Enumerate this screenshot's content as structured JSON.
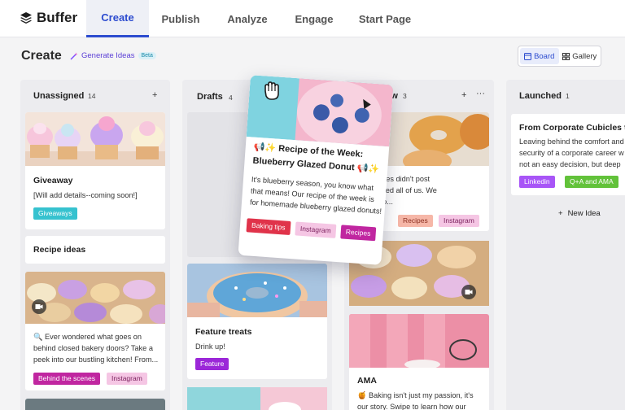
{
  "app": {
    "logo_text": "Buffer"
  },
  "nav": {
    "tabs": [
      "Create",
      "Publish",
      "Analyze",
      "Engage",
      "Start Page"
    ]
  },
  "header": {
    "title": "Create",
    "generate_ideas": "Generate Ideas",
    "beta": "Beta"
  },
  "view": {
    "board": "Board",
    "gallery": "Gallery"
  },
  "columns": {
    "unassigned": {
      "title": "Unassigned",
      "count": "14"
    },
    "drafts": {
      "title": "Drafts",
      "count": "4"
    },
    "review": {
      "title": "Review",
      "count": "3"
    },
    "launched": {
      "title": "Launched",
      "count": "1"
    }
  },
  "cards": {
    "giveaway": {
      "title": "Giveaway",
      "text": "[Will add details--coming soon!]",
      "tag": "Giveaways"
    },
    "recipe_ideas": {
      "title": "Recipe ideas"
    },
    "bakery": {
      "lines": [
        "🔍 Ever wondered what goes on",
        "behind closed bakery doors? Take a",
        "peek into our bustling kitchen! From..."
      ],
      "tags": [
        "Behind the scenes",
        "Instagram"
      ]
    },
    "feature_treats": {
      "title": "Feature treats",
      "text": "Drink up!",
      "tag": "Feature"
    },
    "review_card": {
      "lines": [
        "t of profiles didn't post",
        "s surprised all of us. We",
        "f it was o..."
      ],
      "tags": [
        "Recipes",
        "Instagram"
      ]
    },
    "ama": {
      "title": "AMA",
      "lines": [
        "🍯 Baking isn't just my passion, it's",
        "our story. Swipe to learn how our"
      ]
    },
    "launched_card": {
      "title": "From Corporate Cubicles to",
      "lines": [
        "Leaving behind the comfort and",
        "security of a corporate career w",
        "not an easy decision, but deep"
      ],
      "tags": [
        "Linkedin",
        "Q+A and AMA"
      ]
    },
    "floating": {
      "title_lines": [
        "📢✨ Recipe of the Week:",
        "Blueberry Glazed Donut 📢✨"
      ],
      "lines": [
        "It's blueberry season, you know what",
        "that means! Our recipe of the week is",
        "for homemade blueberry glazed donuts!"
      ],
      "tags": [
        "Baking tips",
        "Instagram",
        "Recipes"
      ]
    }
  },
  "new_idea": "New Idea",
  "colors": {
    "accent": "#2c4bcf",
    "giveaways_tag": "#36c2cf",
    "pink_tag": "#c026a0",
    "feature_tag": "#9b27d8",
    "linkedin_tag": "#a855f7",
    "qa_tag": "#62c23a",
    "red_tag": "#e0334a"
  }
}
